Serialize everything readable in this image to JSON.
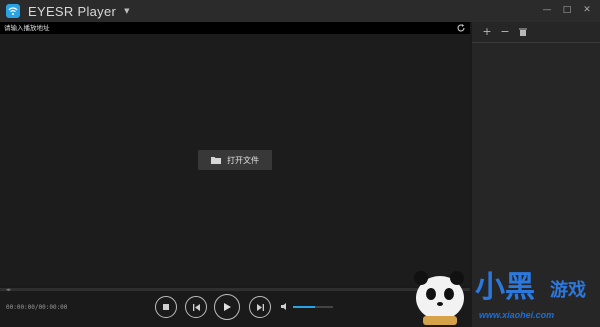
{
  "window": {
    "title": "EYESR Player",
    "minimize_icon": "minus",
    "maximize_icon": "square",
    "close_icon": "x"
  },
  "url_bar": {
    "placeholder": "请输入播放地址"
  },
  "video": {
    "open_file_label": "打开文件"
  },
  "playlist": {
    "add_icon": "+",
    "remove_icon": "−",
    "delete_icon": "trash"
  },
  "controls": {
    "time": "00:00:00/00:00:00",
    "volume_percent": 55
  },
  "watermark": {
    "text_primary": "小黑",
    "text_secondary": "游戏",
    "url": "www.xiaohei.com"
  },
  "colors": {
    "accent": "#2aa3e6",
    "background": "#1a1a1a",
    "panel": "#262626"
  }
}
